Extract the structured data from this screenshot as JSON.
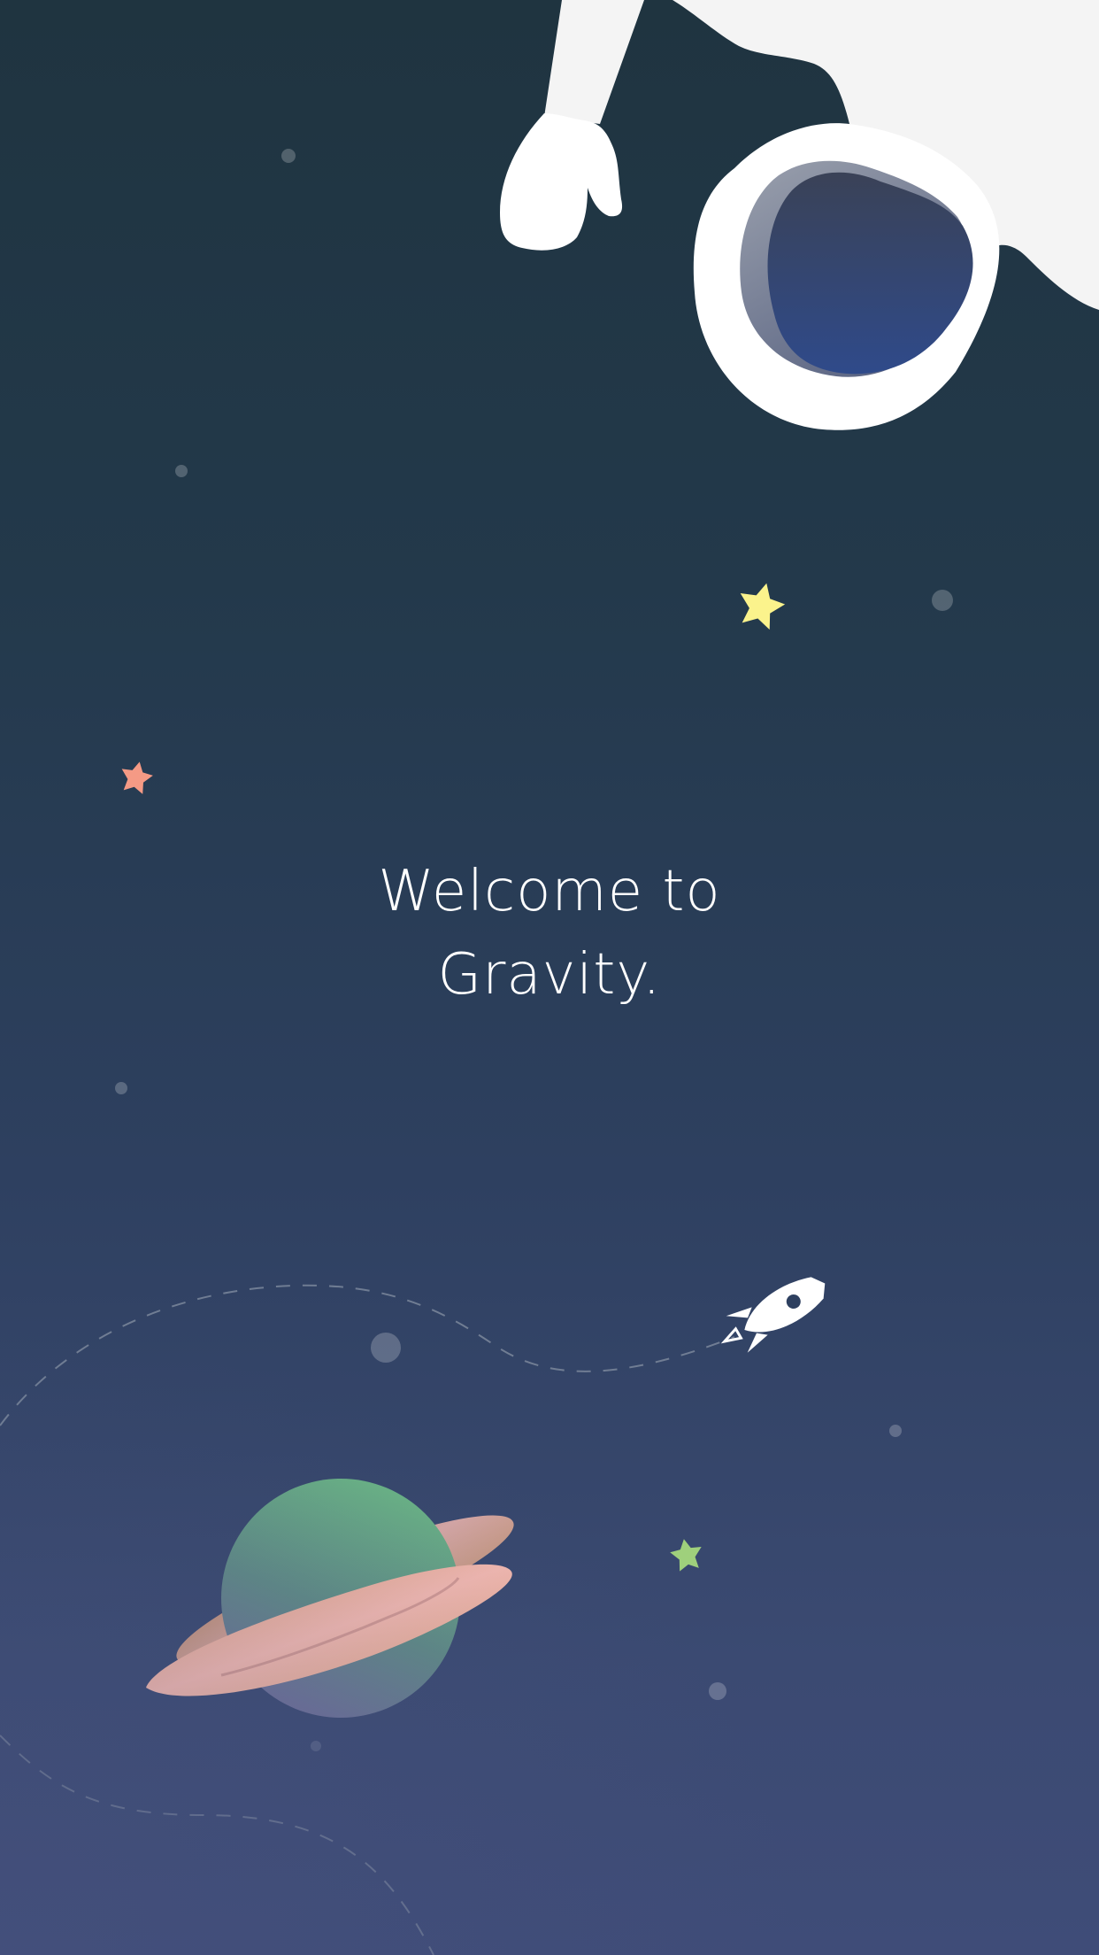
{
  "screen": {
    "welcome_line1": "Welcome to",
    "welcome_line2": "Gravity."
  },
  "colors": {
    "background_top": "#1f3440",
    "background_bottom": "#3f4c78",
    "astronaut_suit": "#f4f4f4",
    "visor": "#2f4a8a",
    "planet": "#6ab585",
    "planet_ring": "#f2b8b0",
    "star_yellow": "#fbf38c",
    "star_pink": "#f59a85",
    "star_green": "#9fd07c",
    "rocket": "#ffffff"
  },
  "icons": {
    "astronaut": "astronaut-icon",
    "rocket": "rocket-icon",
    "planet": "planet-icon",
    "star": "star-icon"
  }
}
